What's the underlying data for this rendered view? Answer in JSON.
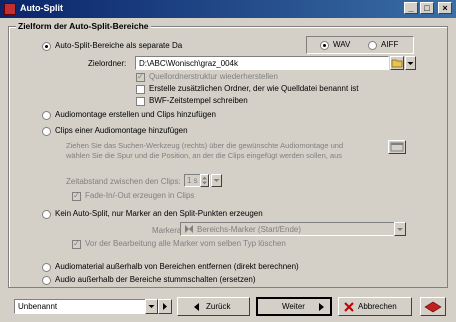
{
  "window": {
    "title": "Auto-Split"
  },
  "group": {
    "title": "Zielform der Auto-Split-Bereiche"
  },
  "opt_separate": {
    "label": "Auto-Split-Bereiche als separate Da",
    "format_wav": "WAV",
    "format_aiff": "AIFF",
    "target_label": "Zielordner:",
    "target_value": "D:\\ABC\\Wonisch\\graz_004k",
    "cb_structure": "Quellordnerstruktur wiederherstellen",
    "cb_extra_folder": "Erstelle zusätzlichen Ordner, der wie Quelldatei benannt ist",
    "cb_bwf": "BWF-Zeitstempel schreiben"
  },
  "opt_montage_create": {
    "label": "Audiomontage erstellen und Clips hinzufügen"
  },
  "opt_montage_add": {
    "label": "Clips einer Audiomontage hinzufügen",
    "hint_line1": "Ziehen Sie das Suchen-Werkzeug (rechts) über die gewünschte Audiomontage und",
    "hint_line2": "wählen Sie die Spur und die Position, an der die Clips eingefügt werden sollen, aus",
    "gap_label": "Zeitabstand zwischen den Clips:",
    "gap_value": "1 s",
    "cb_fade": "Fade-In/-Out erzeugen in Clips"
  },
  "opt_markers": {
    "label": "Kein Auto-Split, nur Marker an den Split-Punkten erzeugen",
    "marker_type_label": "Markerart:",
    "marker_type_value": "Bereichs-Marker (Start/Ende)",
    "cb_delete": "Vor der Bearbeitung alle Marker vom selben Typ löschen"
  },
  "opt_remove": {
    "label": "Audiomaterial außerhalb von Bereichen entfernen (direkt berechnen)"
  },
  "opt_mute": {
    "label": "Audio außerhalb der Bereiche stummschalten (ersetzen)"
  },
  "footer": {
    "preset_value": "Unbenannt",
    "back_label": "Zurück",
    "next_label": "Weiter",
    "cancel_label": "Abbrechen"
  },
  "colors": {
    "titlebar_start": "#0a246a",
    "titlebar_end": "#3a6ea5",
    "face": "#d4d0c8"
  }
}
